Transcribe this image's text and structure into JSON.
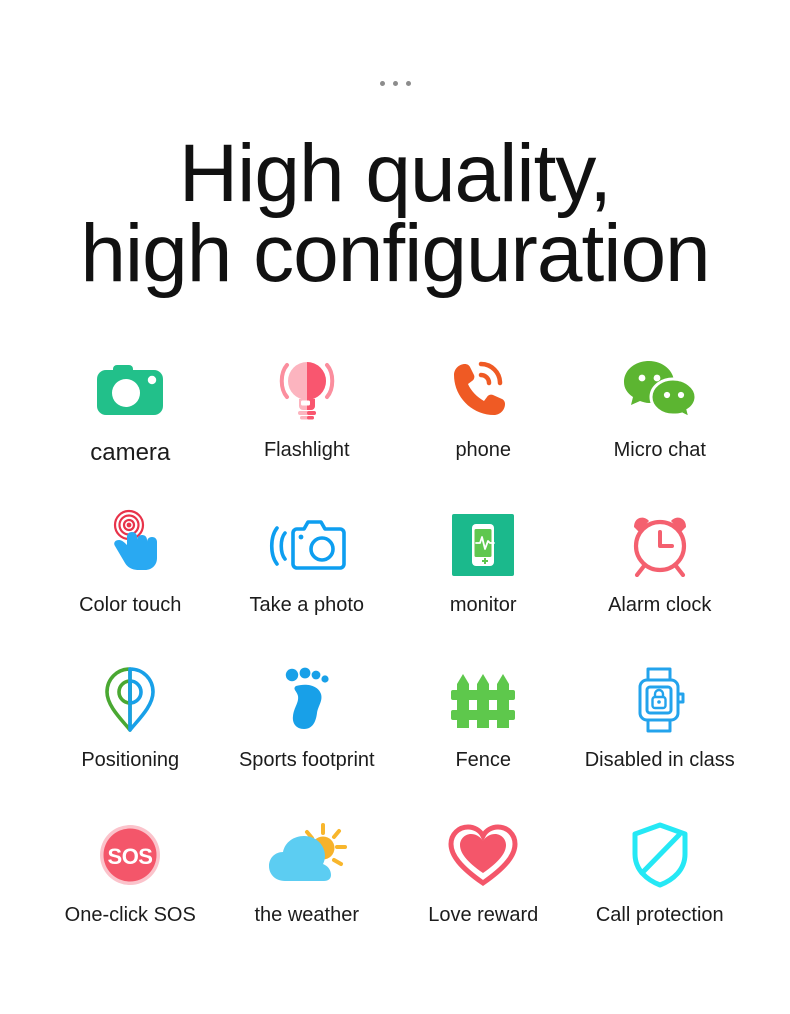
{
  "page": {
    "background": "#ffffff",
    "top_dots": {
      "icon": "ellipsis-dots",
      "count": 3,
      "color": "#8c8c8c"
    }
  },
  "headline": {
    "text": "High quality,\nhigh configuration",
    "line1": "High quality,",
    "line2": "high configuration",
    "color": "#111111"
  },
  "features": {
    "rows": 4,
    "columns": 4,
    "items": [
      {
        "label": "camera",
        "icon": "camera-icon",
        "color": "#22c08a",
        "emphasis": true
      },
      {
        "label": "Flashlight",
        "icon": "flashlight-bulb-icon",
        "color": "#f9657a",
        "emphasis": false
      },
      {
        "label": "phone",
        "icon": "phone-ringing-icon",
        "color": "#ef5a24",
        "emphasis": false
      },
      {
        "label": "Micro chat",
        "icon": "wechat-bubbles-icon",
        "color": "#5cb531",
        "emphasis": false
      },
      {
        "label": "Color touch",
        "icon": "touch-finger-icon",
        "color": "#29a9f2",
        "emphasis": false
      },
      {
        "label": "Take a photo",
        "icon": "remote-camera-icon",
        "color": "#0d9ef0",
        "emphasis": false
      },
      {
        "label": "monitor",
        "icon": "health-monitor-icon",
        "color": "#1bb98c",
        "emphasis": false
      },
      {
        "label": "Alarm clock",
        "icon": "alarm-clock-icon",
        "color": "#f4606f",
        "emphasis": false
      },
      {
        "label": "Positioning",
        "icon": "map-pin-icon",
        "color": "#4aa832",
        "emphasis": false
      },
      {
        "label": "Sports footprint",
        "icon": "footprint-icon",
        "color": "#18a0e8",
        "emphasis": false
      },
      {
        "label": "Fence",
        "icon": "fence-icon",
        "color": "#5ec martial",
        "emphasis": false
      },
      {
        "label": "Disabled in class",
        "icon": "locked-watch-icon",
        "color": "#23a3ec",
        "emphasis": false
      },
      {
        "label": "One-click SOS",
        "icon": "sos-button-icon",
        "color": "#f4566a",
        "emphasis": false
      },
      {
        "label": "the weather",
        "icon": "sun-cloud-icon",
        "color": "#5ccdf2",
        "emphasis": false
      },
      {
        "label": "Love reward",
        "icon": "heart-icon",
        "color": "#f4566a",
        "emphasis": false
      },
      {
        "label": "Call protection",
        "icon": "shield-block-icon",
        "color": "#25e8f5",
        "emphasis": false
      }
    ]
  }
}
